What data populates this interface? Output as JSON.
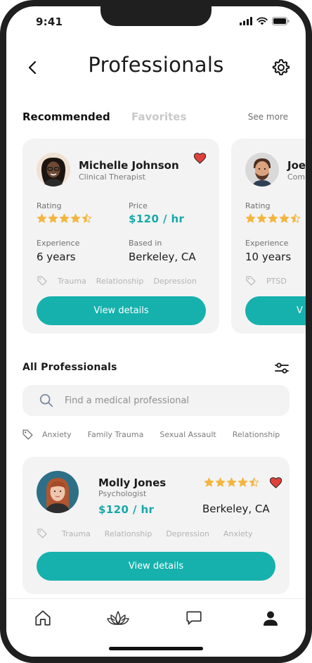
{
  "status_bar": {
    "time": "9:41"
  },
  "header": {
    "title": "Professionals"
  },
  "tabs": {
    "active": "Recommended",
    "inactive": "Favorites",
    "see_more": "See more"
  },
  "recommended": [
    {
      "name": "Michelle Johnson",
      "role": "Clinical Therapist",
      "rating_label": "Rating",
      "rating": 4.5,
      "price_label": "Price",
      "price": "$120 / hr",
      "experience_label": "Experience",
      "experience": "6 years",
      "location_label": "Based in",
      "location": "Berkeley, CA",
      "tags": [
        "Trauma",
        "Relationship",
        "Depression"
      ],
      "button": "View details",
      "favorited": true
    },
    {
      "name": "Joe",
      "role": "Com",
      "rating_label": "Rating",
      "rating": 4.5,
      "experience_label": "Experience",
      "experience": "10 years",
      "tags": [
        "PTSD"
      ],
      "button": "V"
    }
  ],
  "all_professionals": {
    "title": "All Professionals",
    "search_placeholder": "Find a medical professional",
    "chips": [
      "Anxiety",
      "Family Trauma",
      "Sexual Assault",
      "Relationship"
    ],
    "items": [
      {
        "name": "Molly Jones",
        "role": "Psychologist",
        "rating": 4.5,
        "price": "$120 / hr",
        "location": "Berkeley, CA",
        "tags": [
          "Trauma",
          "Relationship",
          "Depression",
          "Anxiety"
        ],
        "button": "View details",
        "favorited": true
      }
    ]
  },
  "bottom_nav": [
    "home-icon",
    "lotus-icon",
    "chat-icon",
    "profile-icon"
  ],
  "colors": {
    "accent": "#16b1ad",
    "price": "#16a8a8",
    "star": "#f2b640",
    "heart": "#e0413a",
    "card": "#f3f3f3"
  }
}
